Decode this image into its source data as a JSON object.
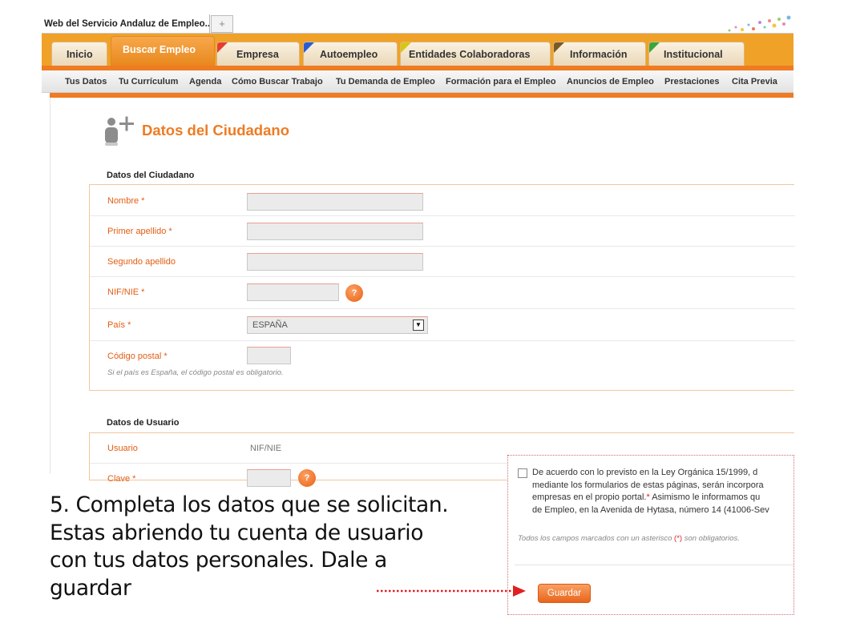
{
  "browser": {
    "tab_title": "Web del Servicio Andaluz de Empleo....",
    "new_tab_symbol": "+"
  },
  "main_nav": {
    "tabs": [
      {
        "label": "Inicio",
        "flag": ""
      },
      {
        "label": "Buscar Empleo",
        "flag": "",
        "active": true
      },
      {
        "label": "Empresa",
        "flag": "#e63d2d"
      },
      {
        "label": "Autoempleo",
        "flag": "#2a5bd7"
      },
      {
        "label": "Entidades Colaboradoras",
        "flag": "#d9c60f"
      },
      {
        "label": "Información",
        "flag": "#7b5a24"
      },
      {
        "label": "Institucional",
        "flag": "#3aa53a"
      }
    ]
  },
  "sub_nav": {
    "items": [
      "Tus Datos",
      "Tu Currículum",
      "Agenda",
      "Cómo Buscar Trabajo",
      "Tu Demanda de Empleo",
      "Formación para el Empleo",
      "Anuncios de Empleo",
      "Prestaciones",
      "Cita Previa"
    ]
  },
  "page": {
    "title": "Datos del Ciudadano"
  },
  "citizen_section": {
    "title": "Datos del Ciudadano",
    "fields": {
      "nombre": {
        "label": "Nombre *",
        "value": ""
      },
      "primer_apellido": {
        "label": "Primer apellido *",
        "value": ""
      },
      "segundo_apellido": {
        "label": "Segundo apellido",
        "value": ""
      },
      "nif": {
        "label": "NIF/NIE *",
        "value": "",
        "help": "?"
      },
      "pais": {
        "label": "País *",
        "value": "ESPAÑA"
      },
      "codigo_postal": {
        "label": "Código postal *",
        "value": "",
        "hint": "Si el país es España, el código postal es obligatorio."
      }
    }
  },
  "user_section": {
    "title": "Datos de Usuario",
    "usuario": {
      "label": "Usuario",
      "value": "NIF/NIE"
    },
    "clave": {
      "label": "Clave *",
      "help": "?"
    }
  },
  "legal": {
    "line1": "De acuerdo con lo previsto en la Ley Orgánica 15/1999, d",
    "line2": "mediante los formularios de estas páginas, serán incorpora",
    "line3_pre": "empresas en el propio portal.",
    "line3_star": "*",
    "line3_post": " Asimismo le informamos qu",
    "line4": "de Empleo, en la Avenida de Hytasa, número 14 (41006-Sev",
    "required_pre": "Todos los campos marcados con un asterisco ",
    "required_star": "(*)",
    "required_post": " son obligatorios."
  },
  "actions": {
    "save_label": "Guardar"
  },
  "caption": {
    "text": "5. Completa los datos que se solicitan. Estas abriendo tu cuenta de usuario con tus datos personales. Dale a guardar"
  },
  "colors": {
    "brand_orange": "#ef7b22",
    "header_orange": "#f0a127",
    "label_orange": "#e35d12",
    "arrow_red": "#e02020"
  }
}
